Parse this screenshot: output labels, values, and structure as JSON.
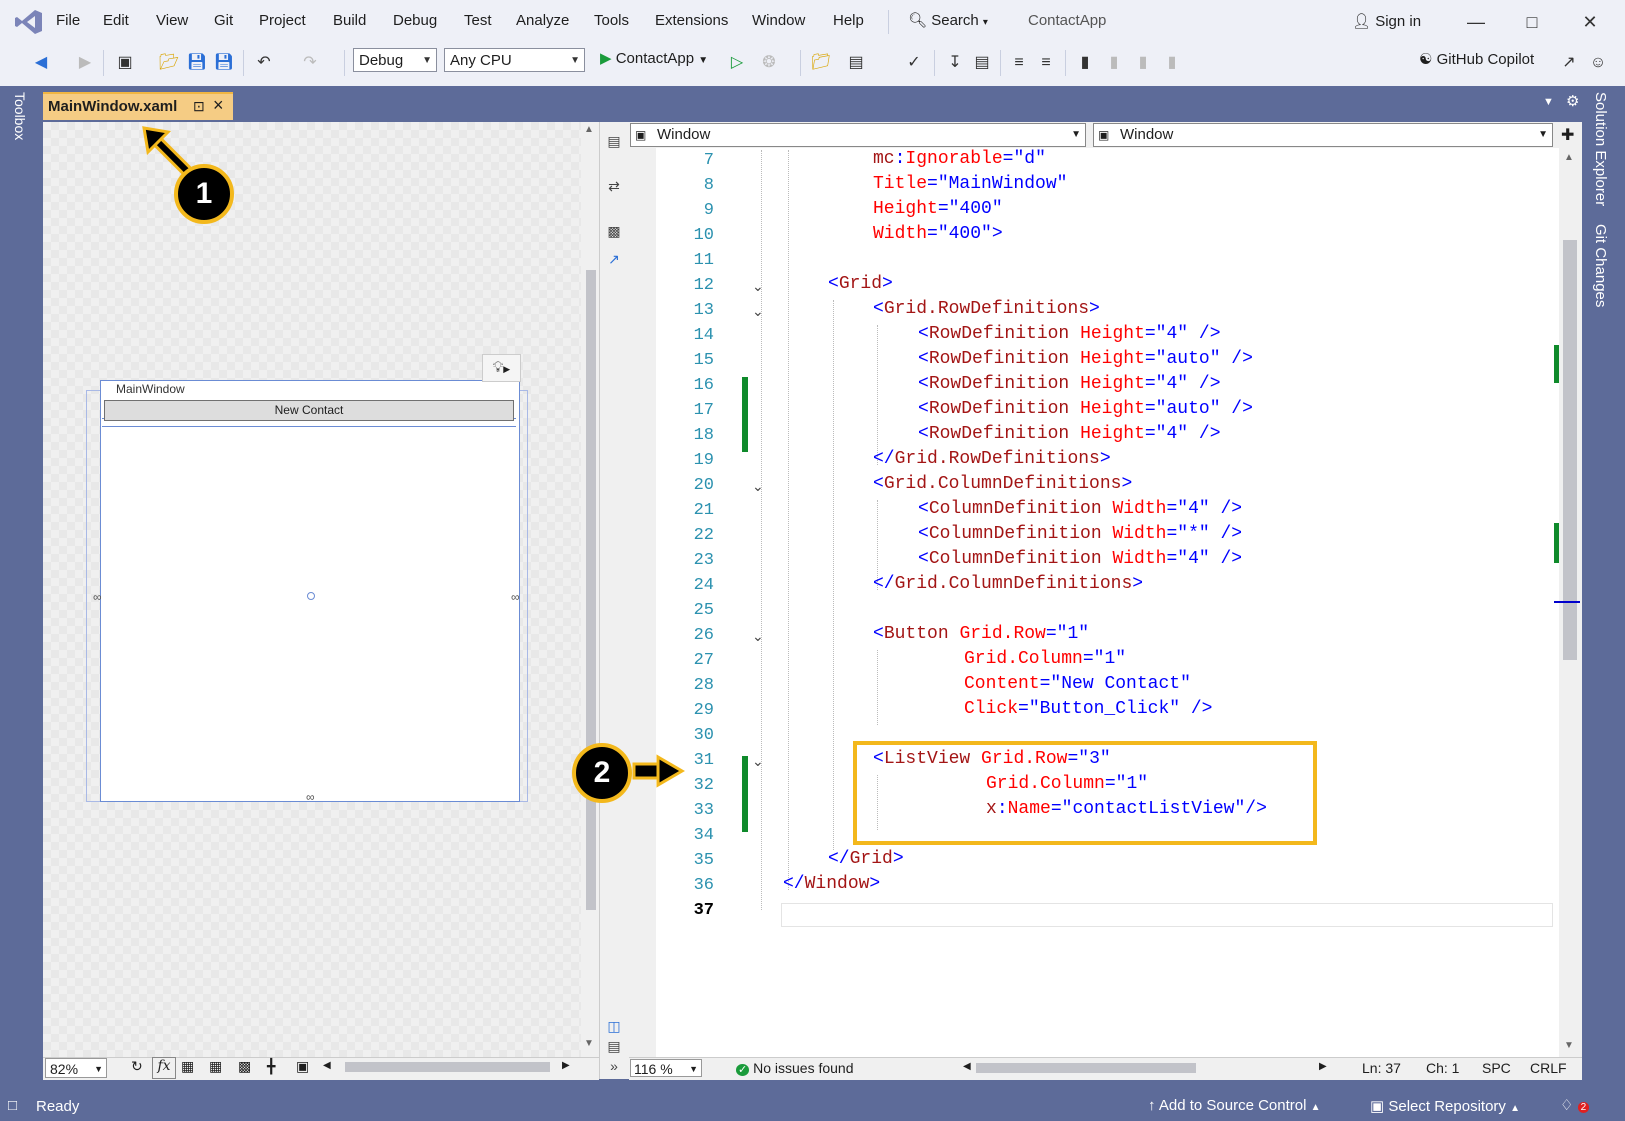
{
  "menubar": {
    "items": [
      "File",
      "Edit",
      "View",
      "Git",
      "Project",
      "Build",
      "Debug",
      "Test",
      "Analyze",
      "Tools",
      "Extensions",
      "Window",
      "Help"
    ],
    "search_label": "Search",
    "app_title": "ContactApp",
    "sign_in": "Sign in"
  },
  "toolbar": {
    "config_value": "Debug",
    "platform_value": "Any CPU",
    "run_label": "ContactApp",
    "copilot_label": "GitHub Copilot"
  },
  "tab": {
    "label": "MainWindow.xaml"
  },
  "side": {
    "toolbox": "Toolbox",
    "solution_explorer": "Solution Explorer",
    "git_changes": "Git Changes"
  },
  "designer": {
    "window_title": "MainWindow",
    "button_content": "New Contact",
    "zoom": "82%",
    "fx_label": "fx"
  },
  "editor": {
    "nav_left": "Window",
    "nav_right": "Window",
    "zoom": "116 %",
    "issues": "No issues found",
    "ln_col": "Ln: 37",
    "ch": "Ch: 1",
    "spc": "SPC",
    "crlf": "CRLF",
    "line_numbers": [
      "7",
      "8",
      "9",
      "10",
      "11",
      "12",
      "13",
      "14",
      "15",
      "16",
      "17",
      "18",
      "19",
      "20",
      "21",
      "22",
      "23",
      "24",
      "25",
      "26",
      "27",
      "28",
      "29",
      "30",
      "31",
      "32",
      "33",
      "34",
      "35",
      "36",
      "37"
    ]
  },
  "status": {
    "ready": "Ready",
    "add_source": "Add to Source Control",
    "select_repo": "Select Repository",
    "notif_count": "2"
  },
  "callouts": {
    "one": "1",
    "two": "2"
  },
  "colors": {
    "frame": "#5d6b99",
    "tab_active": "#f5cc84",
    "callout": "#f3b81c",
    "tag": "#a31515",
    "attribute": "#ff0000",
    "value": "#0000ff",
    "change_bar": "#0f8a2b"
  }
}
